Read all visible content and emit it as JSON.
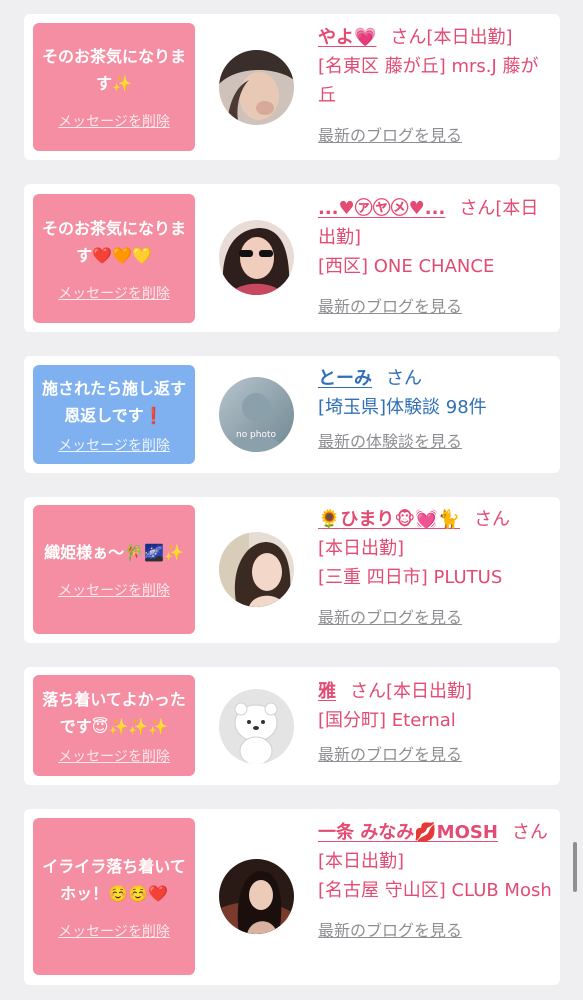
{
  "cards": [
    {
      "bubble_text": "そのお茶気になります✨",
      "delete_label": "メッセージを削除",
      "name": "やよ💗",
      "san": "さん",
      "status": "[本日出勤]",
      "location": "[名東区 藤が丘] mrs.J 藤が丘",
      "blog_label": "最新のブログを見る",
      "bubble_color": "#f58ea3"
    },
    {
      "bubble_text": "そのお茶気になります❤️🧡💛",
      "delete_label": "メッセージを削除",
      "name": "...♥㋐㋳㋱♥...",
      "san": "さん",
      "status": "[本日出勤]",
      "location": "[西区] ONE CHANCE",
      "blog_label": "最新のブログを見る",
      "bubble_color": "#f58ea3"
    },
    {
      "bubble_text": "施されたら施し返す恩返しです❗️",
      "delete_label": "メッセージを削除",
      "name": "とーみ",
      "san": "さん",
      "location": "[埼玉県]体験談 98件",
      "blog_label": "最新の体験談を見る",
      "avatar_text": "no photo",
      "bubble_color": "#7fb0ef"
    },
    {
      "bubble_text": "織姫様ぁ～🎋🌌✨",
      "delete_label": "メッセージを削除",
      "name": "🌻ひまり🐵💓🐈",
      "san": "さん",
      "status": "[本日出勤]",
      "location": "[三重 四日市] PLUTUS",
      "blog_label": "最新のブログを見る",
      "bubble_color": "#f58ea3"
    },
    {
      "bubble_text": "落ち着いてよかったです😇✨✨✨",
      "delete_label": "メッセージを削除",
      "name": "雅",
      "san": "さん",
      "status": "[本日出勤]",
      "location": "[国分町] Eternal",
      "blog_label": "最新のブログを見る",
      "bubble_color": "#f58ea3"
    },
    {
      "bubble_text": "イライラ落ち着いてホッ！☺️☺️❤️",
      "delete_label": "メッセージを削除",
      "name": "一条 みなみ💋MOSH",
      "san": "さん",
      "status": "[本日出勤]",
      "location": "[名古屋 守山区] CLUB Mosh",
      "blog_label": "最新のブログを見る",
      "bubble_color": "#f58ea3"
    }
  ]
}
